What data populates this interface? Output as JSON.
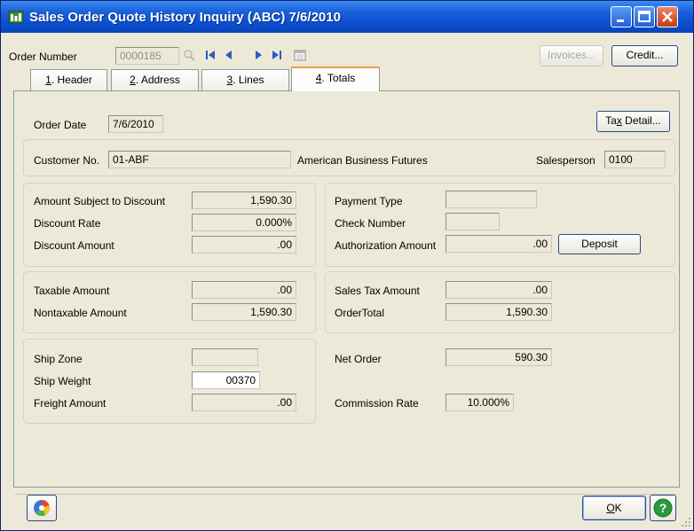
{
  "window": {
    "title": "Sales Order Quote History Inquiry (ABC) 7/6/2010"
  },
  "toolbar": {
    "order_number_label": "Order Number",
    "order_number_value": "0000185",
    "invoices_label": "Invoices...",
    "credit_label": "Credit..."
  },
  "tabs": [
    {
      "key": "1",
      "label": ". Header"
    },
    {
      "key": "2",
      "label": ". Address"
    },
    {
      "key": "3",
      "label": ". Lines"
    },
    {
      "key": "4",
      "label": ". Totals"
    }
  ],
  "header": {
    "order_date_label": "Order Date",
    "order_date_value": "7/6/2010",
    "tax_detail_pre": "Ta",
    "tax_detail_key": "x",
    "tax_detail_post": " Detail...",
    "customer_no_label": "Customer No.",
    "customer_no_value": "01-ABF",
    "customer_name": "American Business Futures",
    "salesperson_label": "Salesperson",
    "salesperson_value": "0100"
  },
  "discount": {
    "amount_subject_label": "Amount Subject to Discount",
    "amount_subject_value": "1,590.30",
    "rate_label": "Discount Rate",
    "rate_value": "0.000%",
    "amount_label": "Discount Amount",
    "amount_value": ".00"
  },
  "payment": {
    "type_label": "Payment Type",
    "type_value": "",
    "check_label": "Check Number",
    "check_value": "",
    "auth_label": "Authorization Amount",
    "auth_value": ".00",
    "deposit_label": "Deposit"
  },
  "taxable": {
    "taxable_label": "Taxable Amount",
    "taxable_value": ".00",
    "nontaxable_label": "Nontaxable Amount",
    "nontaxable_value": "1,590.30"
  },
  "totals": {
    "sales_tax_label": "Sales Tax Amount",
    "sales_tax_value": ".00",
    "order_total_label": "OrderTotal",
    "order_total_value": "1,590.30"
  },
  "shipping": {
    "zone_label": "Ship Zone",
    "zone_value": "",
    "weight_label": "Ship Weight",
    "weight_value": "00370",
    "freight_label": "Freight Amount",
    "freight_value": ".00"
  },
  "net": {
    "net_order_label": "Net Order",
    "net_order_value": "590.30",
    "commission_label": "Commission Rate",
    "commission_value": "10.000%"
  },
  "footer": {
    "ok_key": "O",
    "ok_rest": "K"
  },
  "colors": {
    "titlebar": "#0b4fd1",
    "window_bg": "#ece9d8",
    "tab_highlight": "#e8a13b"
  }
}
